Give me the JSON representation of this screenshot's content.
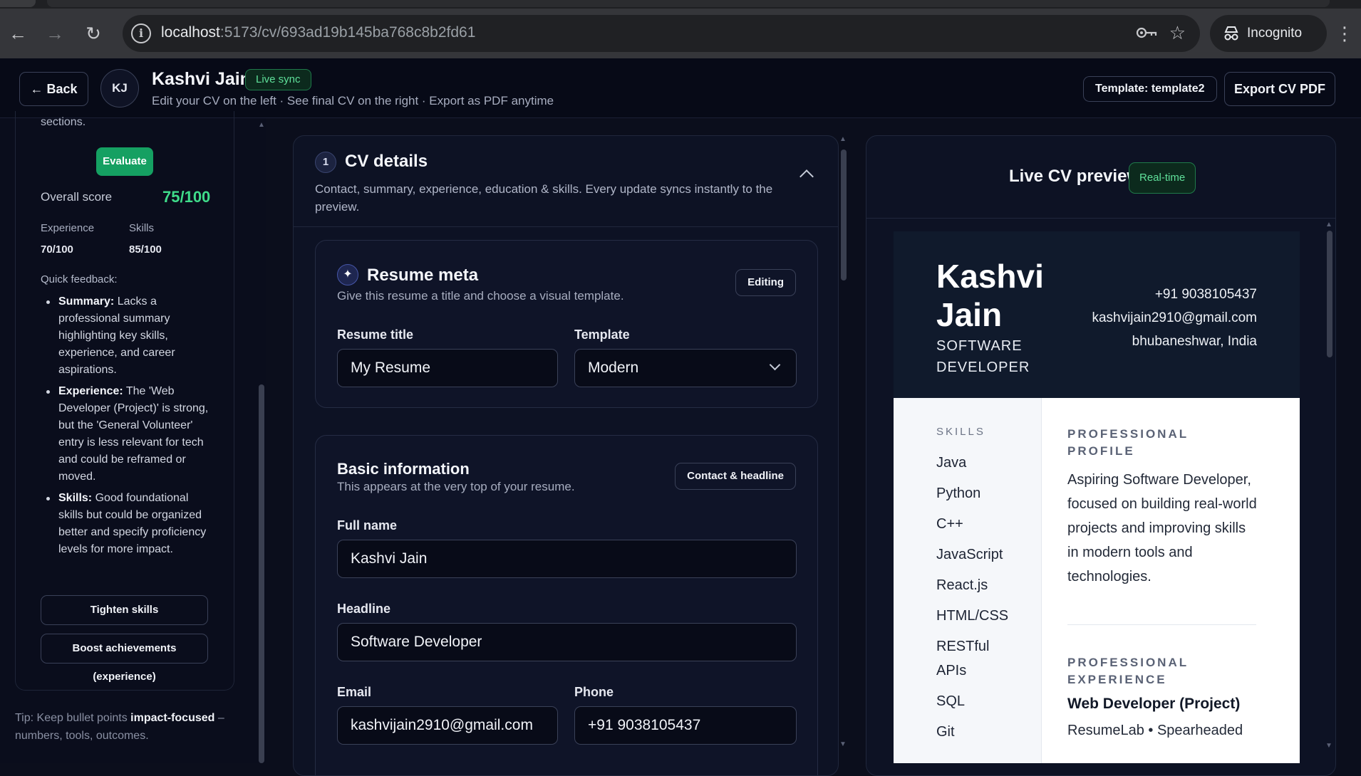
{
  "browser": {
    "url_host": "localhost",
    "url_path": ":5173/cv/693ad19b145ba768c8b2fd61",
    "incognito_label": "Incognito"
  },
  "header": {
    "back_label": "← Back",
    "avatar_initials": "KJ",
    "user_name": "Kashvi Jain",
    "live_sync_label": "Live sync",
    "subtitle": "Edit your CV on the left · See final CV on the right · Export as PDF anytime",
    "template_label": "Template: template2",
    "export_label": "Export CV PDF"
  },
  "sidebar": {
    "sections_text": "sections.",
    "evaluate_label": "Evaluate",
    "overall_label": "Overall score",
    "overall_value": "75/100",
    "experience_label": "Experience",
    "experience_value": "70/100",
    "skills_label": "Skills",
    "skills_value": "85/100",
    "quick_feedback_label": "Quick feedback:",
    "feedback": [
      {
        "title": "Summary:",
        "text": "Lacks a professional summary highlighting key skills, experience, and career aspirations."
      },
      {
        "title": "Experience:",
        "text": "The 'Web Developer (Project)' is strong, but the 'General Volunteer' entry is less relevant for tech and could be reframed or moved."
      },
      {
        "title": "Skills:",
        "text": "Good foundational skills but could be organized better and specify proficiency levels for more impact."
      }
    ],
    "tighten_label": "Tighten skills",
    "boost_label": "Boost achievements (experience)",
    "tip_prefix": "Tip: Keep bullet points ",
    "tip_bold": "impact-focused",
    "tip_suffix": " – numbers, tools, outcomes."
  },
  "editor": {
    "step_number": "1",
    "title": "CV details",
    "description": "Contact, summary, experience, education & skills. Every update syncs instantly to the preview.",
    "meta": {
      "title": "Resume meta",
      "subtitle": "Give this resume a title and choose a visual template.",
      "badge": "Editing",
      "resume_title_label": "Resume title",
      "resume_title_value": "My Resume",
      "template_label": "Template",
      "template_value": "Modern"
    },
    "basic": {
      "title": "Basic information",
      "subtitle": "This appears at the very top of your resume.",
      "badge": "Contact & headline",
      "full_name_label": "Full name",
      "full_name_value": "Kashvi Jain",
      "headline_label": "Headline",
      "headline_value": "Software Developer",
      "email_label": "Email",
      "email_value": "kashvijain2910@gmail.com",
      "phone_label": "Phone",
      "phone_value": "+91 9038105437"
    }
  },
  "preview": {
    "title": "Live CV preview",
    "badge": "Real-time",
    "resume": {
      "name": "Kashvi Jain",
      "headline": "SOFTWARE DEVELOPER",
      "phone": "+91 9038105437",
      "email": "kashvijain2910@gmail.com",
      "location": "bhubaneshwar, India",
      "skills_heading": "SKILLS",
      "skills": [
        "Java",
        "Python",
        "C++",
        "JavaScript",
        "React.js",
        "HTML/CSS",
        "RESTful APIs",
        "SQL",
        "Git"
      ],
      "profile_heading": "PROFESSIONAL PROFILE",
      "profile_text": "Aspiring Software Developer, focused on building real-world projects and improving skills in modern tools and technologies.",
      "experience_heading": "PROFESSIONAL EXPERIENCE",
      "job_title": "Web Developer (Project)",
      "job_sub": "ResumeLab • Spearheaded"
    }
  },
  "colors": {
    "accent_green": "#15a062",
    "score_green": "#3fdc8a",
    "background": "#0b0e1c",
    "resume_header": "#101a2c"
  }
}
